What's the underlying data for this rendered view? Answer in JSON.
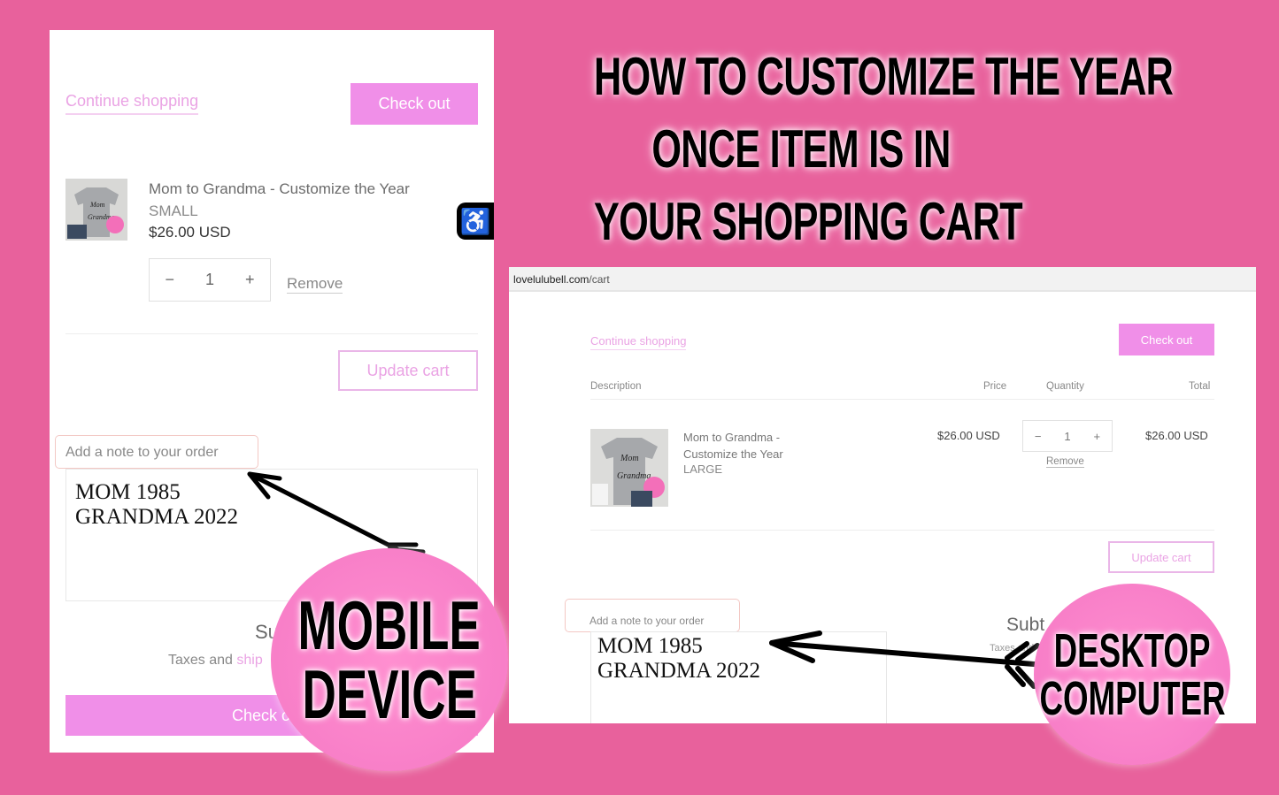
{
  "headline": {
    "lines": [
      "HOW TO CUSTOMIZE THE YEAR",
      "ONCE ITEM IS IN",
      "YOUR SHOPPING CART"
    ]
  },
  "colors": {
    "background": "#e8619c",
    "accent": "#f08fe8",
    "badge": "#f87fc8"
  },
  "mobile": {
    "continue_shopping": "Continue shopping",
    "checkout": "Check out",
    "product": {
      "name": "Mom to Grandma - Customize the Year",
      "variant": "SMALL",
      "price": "$26.00 USD",
      "quantity": "1",
      "minus": "−",
      "plus": "+",
      "remove": "Remove"
    },
    "update_cart": "Update cart",
    "note_label": "Add a note to your order",
    "note_value": "MOM 1985\nGRANDMA 2022",
    "subtotal_partial": "Su",
    "taxes_text": "Taxes and ",
    "taxes_link_partial": "ship",
    "checkout_bottom_partial": "Check o",
    "accessibility_icon": "♿",
    "badge": [
      "MOBILE",
      "DEVICE"
    ]
  },
  "desktop": {
    "url_domain": "lovelulubell.com",
    "url_path": "/cart",
    "continue_shopping": "Continue shopping",
    "checkout": "Check out",
    "columns": [
      "Description",
      "Price",
      "Quantity",
      "Total"
    ],
    "product": {
      "name": "Mom to Grandma - Customize the Year",
      "variant": "LARGE",
      "price": "$26.00 USD",
      "quantity": "1",
      "minus": "−",
      "plus": "+",
      "remove": "Remove",
      "total": "$26.00 USD"
    },
    "update_cart": "Update cart",
    "note_label": "Add a note to your order",
    "note_value": "MOM 1985\nGRANDMA 2022",
    "subtotal_partial": "Subt",
    "taxes_partial": "Taxes and",
    "badge": [
      "DESKTOP",
      "COMPUTER"
    ]
  }
}
